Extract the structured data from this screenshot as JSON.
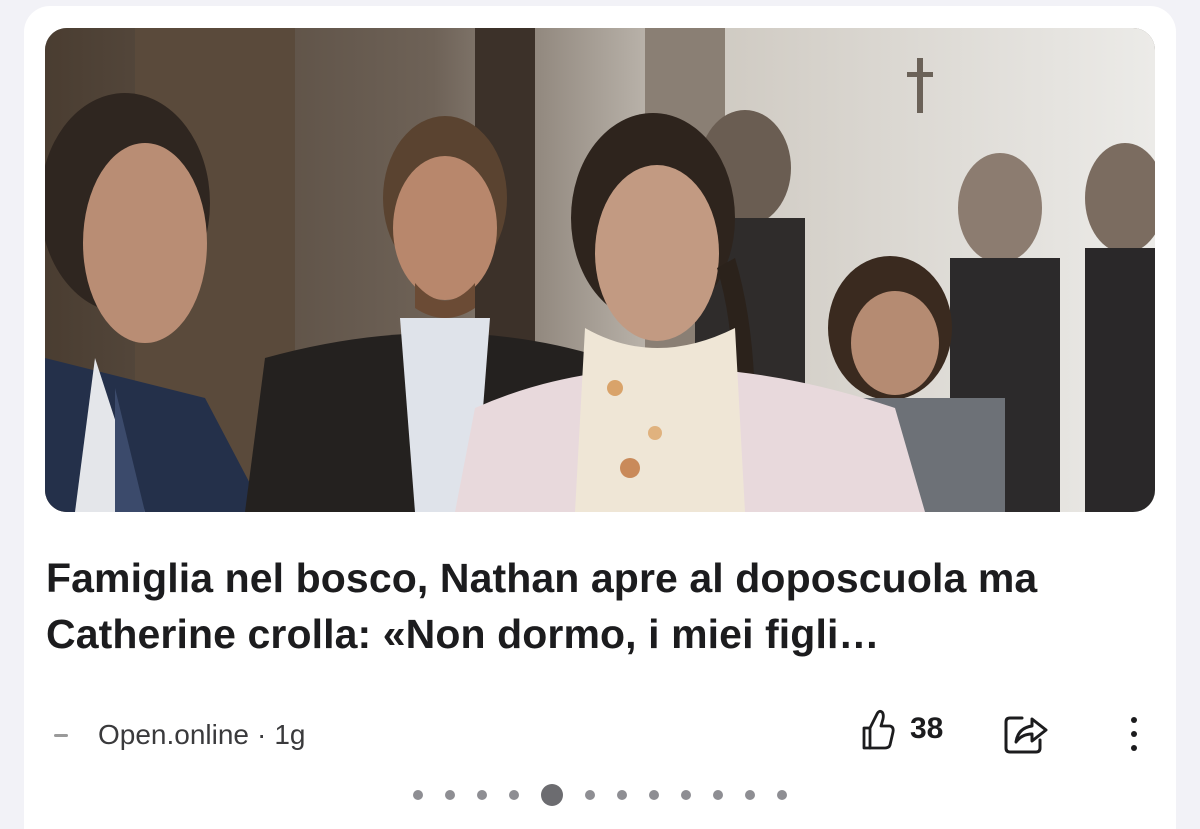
{
  "article": {
    "image_alt": "Photo of people walking in a courthouse corridor",
    "headline": "Famiglia nel bosco, Nathan apre al doposcuola ma Catherine crolla: «Non dormo, i miei figli…"
  },
  "meta": {
    "source": "Open.online",
    "separator": "·",
    "time": "1g"
  },
  "actions": {
    "like_count": "38",
    "like_icon": "thumbs-up-icon",
    "share_icon": "share-icon",
    "more_icon": "more-vertical-icon"
  },
  "pager": {
    "total": 12,
    "active_index": 4
  }
}
